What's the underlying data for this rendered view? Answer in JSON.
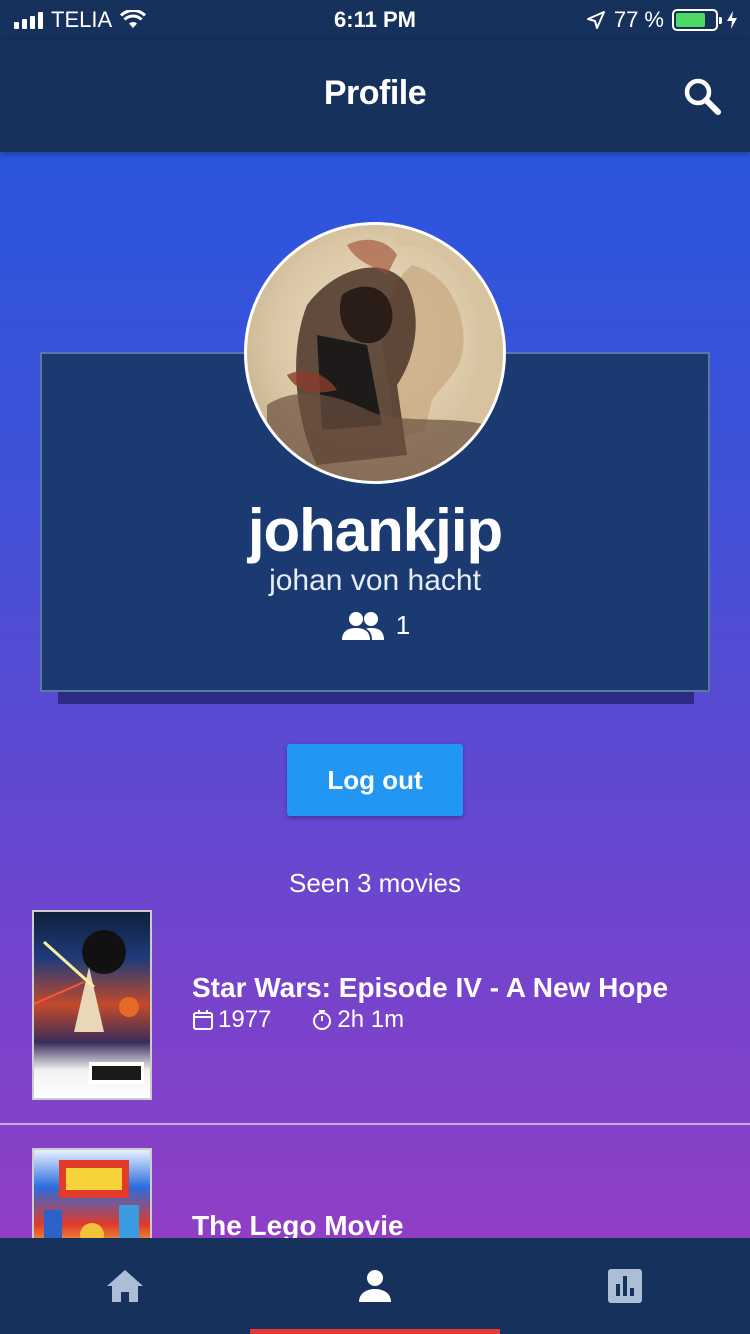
{
  "status_bar": {
    "carrier": "TELIA",
    "time": "6:11 PM",
    "battery_percent": "77 %",
    "battery_level": 0.77
  },
  "appbar": {
    "title": "Profile",
    "search_icon": "search-icon"
  },
  "profile": {
    "username": "johankjip",
    "full_name": "johan von hacht",
    "followers_count": "1",
    "followers_icon": "people-icon"
  },
  "logout_label": "Log out",
  "seen_text": "Seen 3 movies",
  "movies": [
    {
      "title": "Star Wars: Episode IV - A New Hope",
      "year": "1977",
      "runtime": "2h 1m"
    },
    {
      "title": "The Lego Movie"
    }
  ],
  "bottom_nav": {
    "items": [
      {
        "icon": "home-icon"
      },
      {
        "icon": "person-icon"
      },
      {
        "icon": "stats-icon"
      }
    ],
    "active_index": 1
  },
  "colors": {
    "bar_background": "#16325c",
    "card_background": "#1c3a72",
    "button_blue": "#2196f3",
    "active_indicator": "#e53935",
    "battery_green": "#4cd964"
  }
}
